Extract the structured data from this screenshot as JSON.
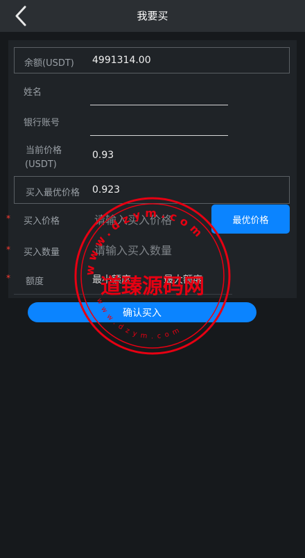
{
  "header": {
    "title": "我要买"
  },
  "balance": {
    "label": "余额(USDT)",
    "value": "4991314.00"
  },
  "name": {
    "label": "姓名",
    "value": ""
  },
  "bank_account": {
    "label": "银行账号",
    "value": ""
  },
  "current_price": {
    "label_line1": "当前价格",
    "label_line2": "(USDT)",
    "value": "0.93"
  },
  "best_buy_price": {
    "label": "买入最优价格",
    "value": "0.923"
  },
  "buy_price": {
    "label": "买入价格",
    "placeholder": "请输入买入价格",
    "required_mark": "*"
  },
  "best_price_button": {
    "label": "最优价格"
  },
  "buy_quantity": {
    "label": "买入数量",
    "placeholder": "请输入买入数量",
    "required_mark": "*"
  },
  "amount": {
    "label": "额度",
    "min_label": "最小额度",
    "max_label": "最大额度",
    "required_mark": "*"
  },
  "confirm_button": {
    "label": "确认买入"
  },
  "watermark": {
    "text": "道臻源码网",
    "url_top": "www.dzym.com",
    "url_bottom": "www.dzym.com"
  },
  "colors": {
    "accent": "#0b84ff",
    "required": "#ff3b30",
    "watermark": "#e60012"
  }
}
